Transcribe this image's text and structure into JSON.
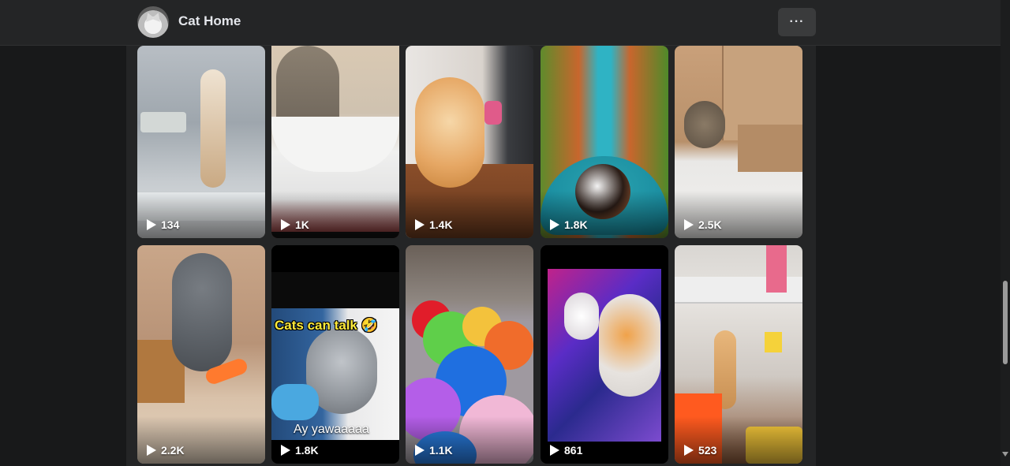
{
  "header": {
    "page_title": "Cat Home",
    "more_label": "···"
  },
  "reels": [
    {
      "views": "134"
    },
    {
      "views": "1K"
    },
    {
      "views": "1.4K"
    },
    {
      "views": "1.8K"
    },
    {
      "views": "2.5K"
    },
    {
      "views": "2.2K"
    },
    {
      "views": "1.8K",
      "caption_top": "Cats can talk 🤣",
      "caption_bottom": "Ay yawaaaaa"
    },
    {
      "views": "1.1K"
    },
    {
      "views": "861"
    },
    {
      "views": "523"
    }
  ],
  "icons": {
    "play": "play-icon",
    "more": "more-horizontal-icon"
  }
}
